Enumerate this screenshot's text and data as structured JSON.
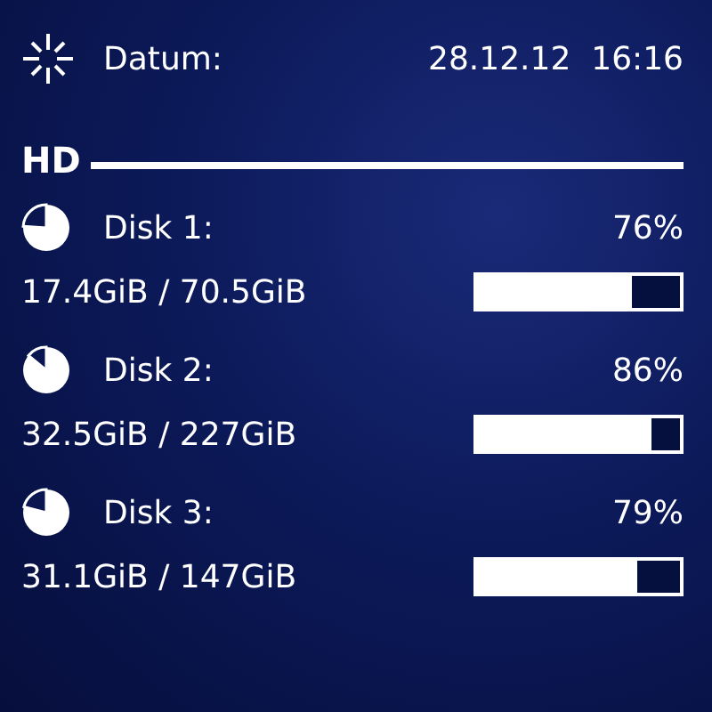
{
  "date_row": {
    "label": "Datum:",
    "value": "28.12.12  16:16"
  },
  "section": {
    "title": "HD"
  },
  "disks": [
    {
      "name": "Disk 1:",
      "percent": "76%",
      "usage": "17.4GiB / 70.5GiB",
      "level": 0.76
    },
    {
      "name": "Disk 2:",
      "percent": "86%",
      "usage": "32.5GiB / 227GiB",
      "level": 0.86
    },
    {
      "name": "Disk 3:",
      "percent": "79%",
      "usage": "31.1GiB / 147GiB",
      "level": 0.79
    }
  ]
}
